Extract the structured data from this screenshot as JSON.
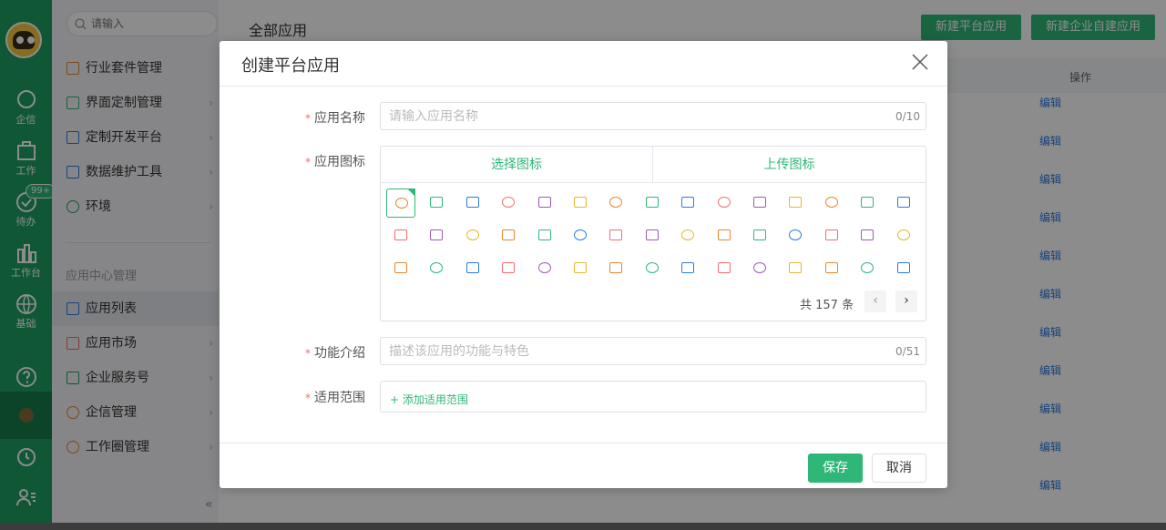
{
  "rail": {
    "items": [
      {
        "label": "企信",
        "icon": "chat-bubble-icon"
      },
      {
        "label": "工作",
        "icon": "briefcase-icon"
      },
      {
        "label": "待办",
        "icon": "check-circle-icon",
        "badge": "99+"
      },
      {
        "label": "工作台",
        "icon": "bar-chart-icon"
      },
      {
        "label": "基础",
        "icon": "globe-icon"
      }
    ]
  },
  "menu": {
    "search_placeholder": "请输入",
    "items": [
      {
        "label": "行业套件管理"
      },
      {
        "label": "界面定制管理"
      },
      {
        "label": "定制开发平台"
      },
      {
        "label": "数据维护工具"
      },
      {
        "label": "环境"
      }
    ],
    "section_title": "应用中心管理",
    "section_items": [
      {
        "label": "应用列表"
      },
      {
        "label": "应用市场"
      },
      {
        "label": "企业服务号"
      },
      {
        "label": "企信管理"
      },
      {
        "label": "工作圈管理"
      }
    ],
    "collapse_glyph": "«"
  },
  "main": {
    "title": "全部应用",
    "new_platform_app": "新建平台应用",
    "new_enterprise_app": "新建企业自建应用",
    "col_operation": "操作",
    "edit_label": "编辑"
  },
  "dialog": {
    "title": "创建平台应用",
    "name_label": "应用名称",
    "name_placeholder": "请输入应用名称",
    "name_counter": "0/10",
    "icon_label": "应用图标",
    "tab_select": "选择图标",
    "tab_upload": "上传图标",
    "total_text": "共 157 条",
    "intro_label": "功能介绍",
    "intro_placeholder": "描述该应用的功能与特色",
    "intro_counter": "0/51",
    "scope_label": "适用范围",
    "scope_add": "+ 添加适用范围",
    "save": "保存",
    "cancel": "取消",
    "icon_colors": [
      "#e8862a",
      "#2eb777",
      "#2a7ae2",
      "#f56c6c",
      "#9b59b6",
      "#e8b52a"
    ]
  }
}
